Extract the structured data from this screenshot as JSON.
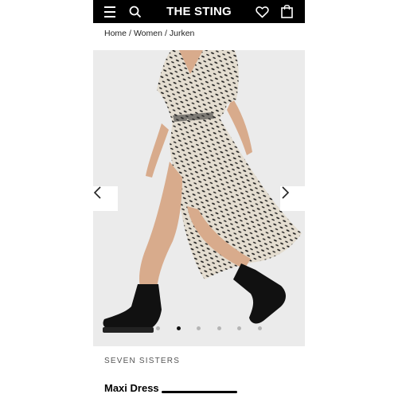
{
  "header": {
    "logo": "THE STING",
    "icons": [
      "menu-icon",
      "search-icon",
      "heart-icon",
      "bag-icon"
    ],
    "background": "#000000"
  },
  "breadcrumb": [
    "Home",
    "Women",
    "Jurken"
  ],
  "breadcrumb_separator": "/",
  "gallery": {
    "image": "leopard-print-maxi-dress-photo",
    "slide_count": 6,
    "active_slide": 1
  },
  "product": {
    "brand": "SEVEN SISTERS",
    "name": "Maxi Dress"
  }
}
